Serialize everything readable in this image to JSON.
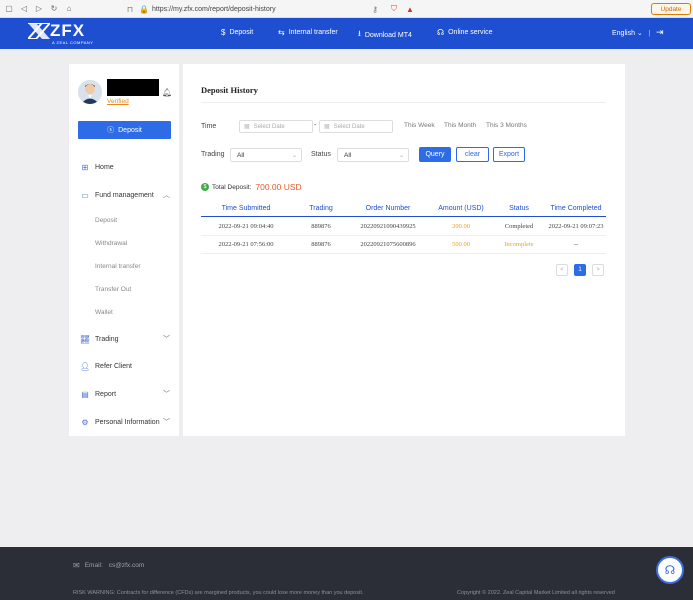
{
  "browser": {
    "url": "https://my.zfx.com/report/deposit-history",
    "update_label": "Update"
  },
  "header": {
    "logo_text": "ZFX",
    "logo_sub": "A ZEAL COMPANY",
    "nav": [
      {
        "label": "Deposit",
        "icon": "dollar-circle-icon"
      },
      {
        "label": "Internal transfer",
        "icon": "transfer-icon"
      },
      {
        "label": "Download MT4",
        "icon": "download-icon"
      },
      {
        "label": "Online service",
        "icon": "headset-icon"
      }
    ],
    "language": "English",
    "accent": "#1f4fd1"
  },
  "sidebar": {
    "verified_label": "Verified",
    "deposit_button": "Deposit",
    "menu": {
      "home": "Home",
      "fund_management": "Fund management",
      "fund_sub": [
        "Deposit",
        "Withdrawal",
        "Internal transfer",
        "Transfer Out",
        "Wallet"
      ],
      "trading": "Trading",
      "refer_client": "Refer Client",
      "report": "Report",
      "personal_information": "Personal Information"
    }
  },
  "main": {
    "title": "Deposit History",
    "filters": {
      "time_label": "Time",
      "start_placeholder": "Select Date",
      "separator": "-",
      "end_placeholder": "Select Date",
      "quick": [
        "This Week",
        "This Month",
        "This 3 Months"
      ],
      "trading_label": "Trading",
      "trading_value": "All",
      "status_label": "Status",
      "status_value": "All"
    },
    "buttons": {
      "query": "Query",
      "clear": "clear",
      "export": "Export"
    },
    "total_label": "Total Deposit:",
    "total_amount": "700.00 USD",
    "table": {
      "columns": [
        "Time Submitted",
        "Trading",
        "Order Number",
        "Amount (USD)",
        "Status",
        "Time Completed"
      ],
      "rows": [
        [
          "2022-09-21 09:04:40",
          "889876",
          "20220921090439925",
          "200.00",
          "Completed",
          "2022-09-21 09:07:23"
        ],
        [
          "2022-09-21 07:56:00",
          "889876",
          "20220921075600896",
          "500.00",
          "Incomplete",
          "--"
        ]
      ]
    },
    "pagination": {
      "prev": "<",
      "current": "1",
      "next": ">"
    }
  },
  "footer": {
    "email_label": "Email:",
    "email": "cs@zfx.com",
    "risk_warning": "RISK WARNING: Contracts for difference (CFDs) are margined products, you could lose more money than you deposit.",
    "copyright": "Copyright © 2022. Zeal Capital Market Limited all rights reserved"
  }
}
